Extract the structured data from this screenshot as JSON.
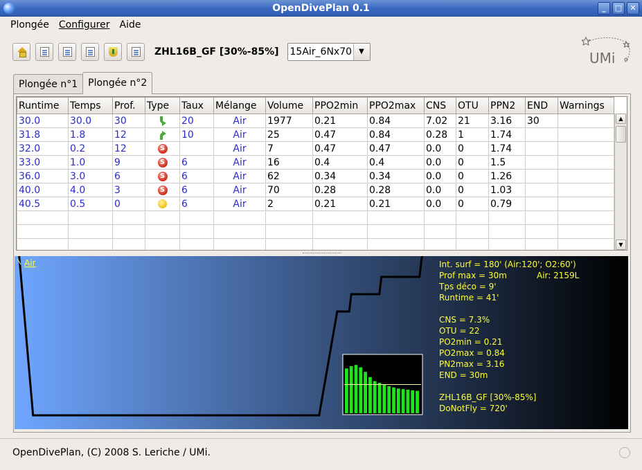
{
  "window": {
    "title": "OpenDivePlan 0.1",
    "buttons": [
      "_",
      "□",
      "✕"
    ]
  },
  "menu": {
    "items": [
      {
        "label": "Plongée"
      },
      {
        "label": "Configurer"
      },
      {
        "label": "Aide"
      }
    ]
  },
  "toolbar": {
    "buttons": [
      "home-icon",
      "refresh-icon",
      "edit-icon",
      "delete-icon",
      "shield-icon",
      "add-icon"
    ],
    "profile_label": "ZHL16B_GF [30%-85%]",
    "gas_select": {
      "value": "15Air_6Nx70"
    }
  },
  "logo": {
    "text": "UMi"
  },
  "tabs": [
    {
      "label": "Plongée n°1",
      "active": false
    },
    {
      "label": "Plongée n°2",
      "active": true
    }
  ],
  "table": {
    "columns": [
      "Runtime",
      "Temps",
      "Prof.",
      "Type",
      "Taux",
      "Mélange",
      "Volume",
      "PPO2min",
      "PPO2max",
      "CNS",
      "OTU",
      "PPN2",
      "END",
      "Warnings"
    ],
    "rows": [
      {
        "runtime": "30.0",
        "temps": "30.0",
        "prof": "30",
        "type": "descent-icon",
        "taux": "20",
        "melange": "Air",
        "volume": "1977",
        "ppo2min": "0.21",
        "ppo2max": "0.84",
        "cns": "7.02",
        "otu": "21",
        "ppn2": "3.16",
        "end": "30",
        "warnings": ""
      },
      {
        "runtime": "31.8",
        "temps": "1.8",
        "prof": "12",
        "type": "ascent-icon",
        "taux": "10",
        "melange": "Air",
        "volume": "25",
        "ppo2min": "0.47",
        "ppo2max": "0.84",
        "cns": "0.28",
        "otu": "1",
        "ppn2": "1.74",
        "end": "",
        "warnings": ""
      },
      {
        "runtime": "32.0",
        "temps": "0.2",
        "prof": "12",
        "type": "stop-icon",
        "taux": "",
        "melange": "Air",
        "volume": "7",
        "ppo2min": "0.47",
        "ppo2max": "0.47",
        "cns": "0.0",
        "otu": "0",
        "ppn2": "1.74",
        "end": "",
        "warnings": ""
      },
      {
        "runtime": "33.0",
        "temps": "1.0",
        "prof": "9",
        "type": "stop-icon",
        "taux": "6",
        "melange": "Air",
        "volume": "16",
        "ppo2min": "0.4",
        "ppo2max": "0.4",
        "cns": "0.0",
        "otu": "0",
        "ppn2": "1.5",
        "end": "",
        "warnings": ""
      },
      {
        "runtime": "36.0",
        "temps": "3.0",
        "prof": "6",
        "type": "stop-icon",
        "taux": "6",
        "melange": "Air",
        "volume": "62",
        "ppo2min": "0.34",
        "ppo2max": "0.34",
        "cns": "0.0",
        "otu": "0",
        "ppn2": "1.26",
        "end": "",
        "warnings": ""
      },
      {
        "runtime": "40.0",
        "temps": "4.0",
        "prof": "3",
        "type": "stop-icon",
        "taux": "6",
        "melange": "Air",
        "volume": "70",
        "ppo2min": "0.28",
        "ppo2max": "0.28",
        "cns": "0.0",
        "otu": "0",
        "ppn2": "1.03",
        "end": "",
        "warnings": ""
      },
      {
        "runtime": "40.5",
        "temps": "0.5",
        "prof": "0",
        "type": "surface-icon",
        "taux": "6",
        "melange": "Air",
        "volume": "2",
        "ppo2min": "0.21",
        "ppo2max": "0.21",
        "cns": "0.0",
        "otu": "0",
        "ppn2": "0.79",
        "end": "",
        "warnings": ""
      }
    ],
    "stop_letter": "S"
  },
  "chart_data": {
    "type": "line",
    "gas_label": "Air",
    "profile": {
      "x": [
        0,
        1.5,
        30,
        31.8,
        32,
        33,
        33.2,
        36,
        36.2,
        40,
        40.2,
        40.5
      ],
      "y": [
        0,
        30,
        30,
        12,
        12,
        12,
        9,
        9,
        6,
        6,
        3,
        0
      ]
    },
    "xlim": [
      0,
      40.5
    ],
    "ylim": [
      0,
      30
    ],
    "info": {
      "surf": "Int. surf = 180' (Air:120'; O2:60')",
      "prof_max": "Prof max = 30m",
      "air": "Air: 2159L",
      "tps_deco": "Tps déco = 9'",
      "runtime": "Runtime = 41'",
      "cns": "CNS = 7.3%",
      "otu": "OTU = 22",
      "po2min": "PO2min = 0.21",
      "po2max": "PO2max = 0.84",
      "pn2max": "PN2max = 3.16",
      "end": "END = 30m",
      "model": "ZHL16B_GF [30%-85%]",
      "donotfly": "DoNotFly = 720'"
    },
    "tissues": {
      "values": [
        0.78,
        0.82,
        0.84,
        0.8,
        0.72,
        0.63,
        0.56,
        0.53,
        0.5,
        0.47,
        0.45,
        0.43,
        0.42,
        0.41,
        0.4,
        0.39
      ],
      "limit": 0.5
    },
    "colors": {
      "bg_left": "#6fa6ff",
      "bg_right": "#000000",
      "profile": "#000000",
      "text": "#ffff33",
      "bars": "#22e022"
    }
  },
  "status": {
    "text": "OpenDivePlan, (C) 2008 S. Leriche / UMi."
  }
}
